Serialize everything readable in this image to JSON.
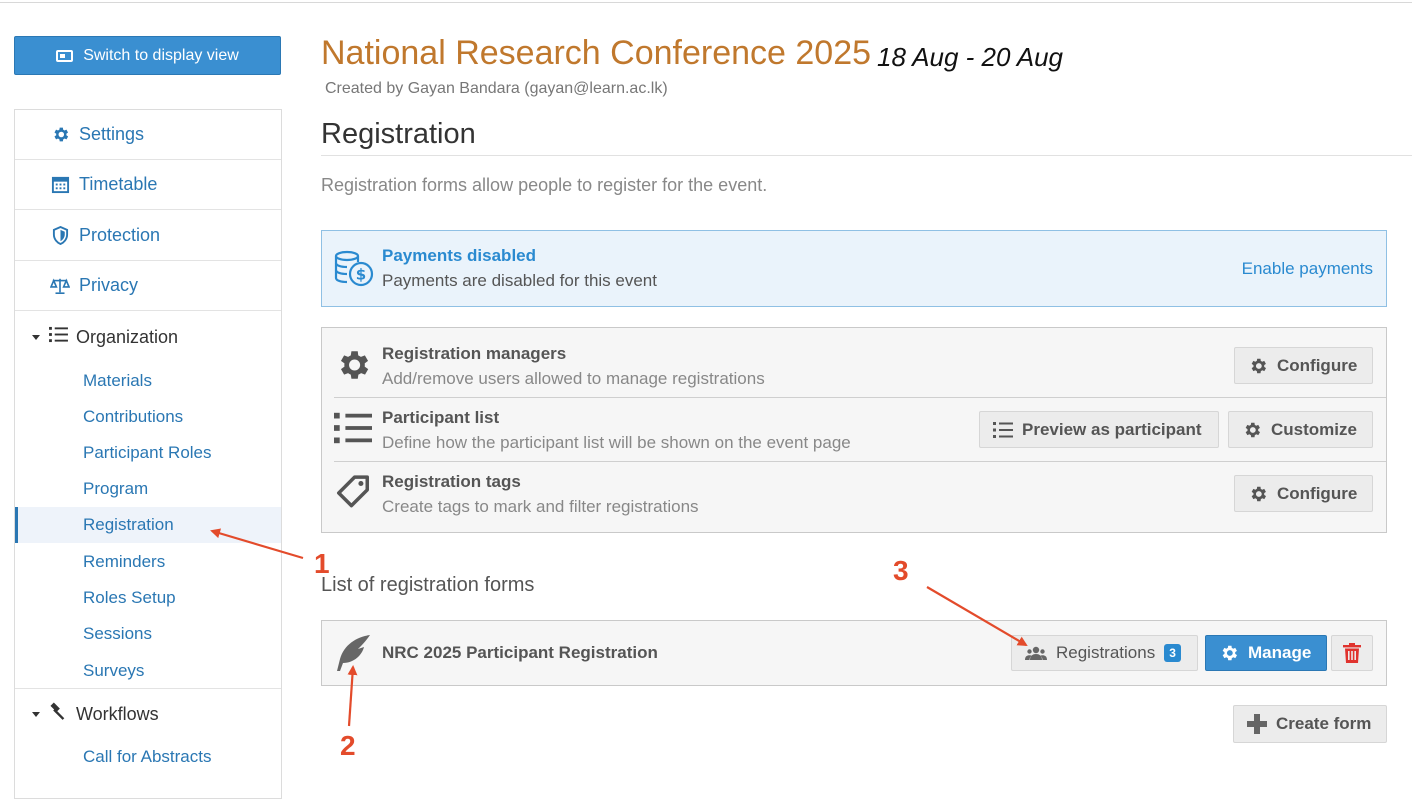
{
  "sidebar": {
    "switch_label": "Switch to display view",
    "items": [
      {
        "label": "Settings",
        "icon": "gear-icon"
      },
      {
        "label": "Timetable",
        "icon": "calendar-icon"
      },
      {
        "label": "Protection",
        "icon": "shield-icon"
      },
      {
        "label": "Privacy",
        "icon": "scale-icon"
      }
    ],
    "organization": {
      "label": "Organization",
      "items": [
        "Materials",
        "Contributions",
        "Participant Roles",
        "Program",
        "Registration",
        "Reminders",
        "Roles Setup",
        "Sessions",
        "Surveys"
      ],
      "active": "Registration"
    },
    "workflows": {
      "label": "Workflows",
      "items": [
        "Call for Abstracts"
      ]
    }
  },
  "event": {
    "title": "National Research Conference 2025",
    "dates": "18 Aug - 20 Aug",
    "created_by": "Created by Gayan Bandara (gayan@learn.ac.lk)"
  },
  "page": {
    "heading": "Registration",
    "description": "Registration forms allow people to register for the event."
  },
  "payments": {
    "title": "Payments disabled",
    "text": "Payments are disabled for this event",
    "link": "Enable payments"
  },
  "management": {
    "rows": [
      {
        "title": "Registration managers",
        "text": "Add/remove users allowed to manage registrations",
        "button": "Configure"
      },
      {
        "title": "Participant list",
        "text": "Define how the participant list will be shown on the event page",
        "preview_button": "Preview as participant",
        "button": "Customize"
      },
      {
        "title": "Registration tags",
        "text": "Create tags to mark and filter registrations",
        "button": "Configure"
      }
    ]
  },
  "forms": {
    "heading": "List of registration forms",
    "items": [
      {
        "name": "NRC 2025 Participant Registration",
        "registrations_label": "Registrations",
        "count": "3",
        "manage_label": "Manage"
      }
    ],
    "create_label": "Create form"
  },
  "annotations": {
    "one": "1",
    "two": "2",
    "three": "3"
  },
  "colors": {
    "accent": "#2a8ad0",
    "title": "#c0782d",
    "annotation": "#e34b2b",
    "delete": "#e0332e"
  }
}
